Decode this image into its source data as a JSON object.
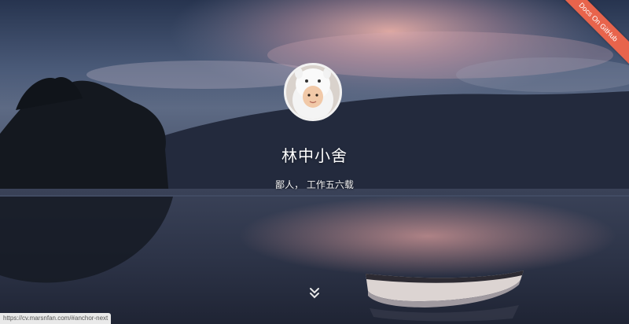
{
  "ribbon": {
    "label": "Docs On GitHub"
  },
  "profile": {
    "name": "林中小舍",
    "bio": "鄙人， 工作五六载"
  },
  "status_bar": {
    "url": "https://cv.marsnfan.com/#anchor-next"
  },
  "colors": {
    "ribbon": "#e8644c",
    "sky_top": "#2f3e5c",
    "sunset_glow": "#e6a0a0",
    "lake": "#2a3144"
  }
}
